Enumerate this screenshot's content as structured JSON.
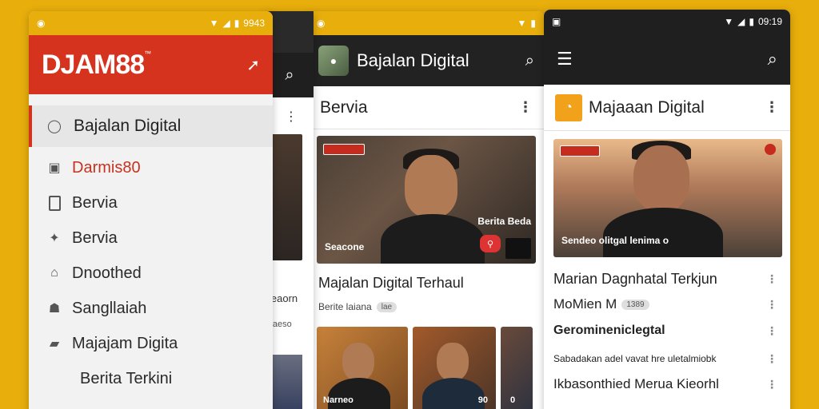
{
  "left_phone": {
    "status": {
      "time": "9943"
    },
    "brand": {
      "name": "DJAM88",
      "mark": "™"
    },
    "drawer": {
      "selected": "Bajalan Digital",
      "items": [
        {
          "label": "Darmis80",
          "icon": "camera-icon",
          "highlight": true
        },
        {
          "label": "Bervia",
          "icon": "document-icon",
          "highlight": false
        },
        {
          "label": "Bervia",
          "icon": "puzzle-icon",
          "highlight": false
        },
        {
          "label": "Dnoothed",
          "icon": "home-icon",
          "highlight": false
        },
        {
          "label": "Sangllaiah",
          "icon": "people-icon",
          "highlight": false
        },
        {
          "label": "Majajam Digita",
          "icon": "briefcase-icon",
          "highlight": false
        },
        {
          "label": "Berita Terkini",
          "icon": "",
          "highlight": false
        }
      ]
    }
  },
  "behind_phone": {
    "text1": "leaorn",
    "text2": "llaeso"
  },
  "mid_phone": {
    "appbar": {
      "title": "Bajalan Digital"
    },
    "section": {
      "title": "Bervia"
    },
    "hero": {
      "caption_right": "Berita Beda",
      "caption_left": "Seacone"
    },
    "headline": "Majalan Digital Terhaul",
    "meta": {
      "text": "Berite laiana",
      "chip": "lae"
    },
    "thumbs": [
      {
        "caption": "Narneo"
      },
      {
        "caption": "90"
      },
      {
        "caption": "0"
      }
    ]
  },
  "right_phone": {
    "status": {
      "time": "09:19"
    },
    "section": {
      "title": "Majaaan Digital"
    },
    "hero": {
      "caption": "Sendeo olitgal lenima o"
    },
    "list": [
      {
        "text": "Marian Dagnhatal Terkjun",
        "size": 18,
        "bold": false
      },
      {
        "text": "MoMien M",
        "chip": "1389",
        "size": 17,
        "bold": false
      },
      {
        "text": "Geromineniclegtal",
        "size": 16,
        "bold": true
      },
      {
        "text": "Sabadakan adel vavat hre uletalmiobk",
        "size": 12,
        "bold": false
      },
      {
        "text": "Ikbasonthied Merua Kieorhl",
        "size": 17,
        "bold": false
      }
    ]
  }
}
